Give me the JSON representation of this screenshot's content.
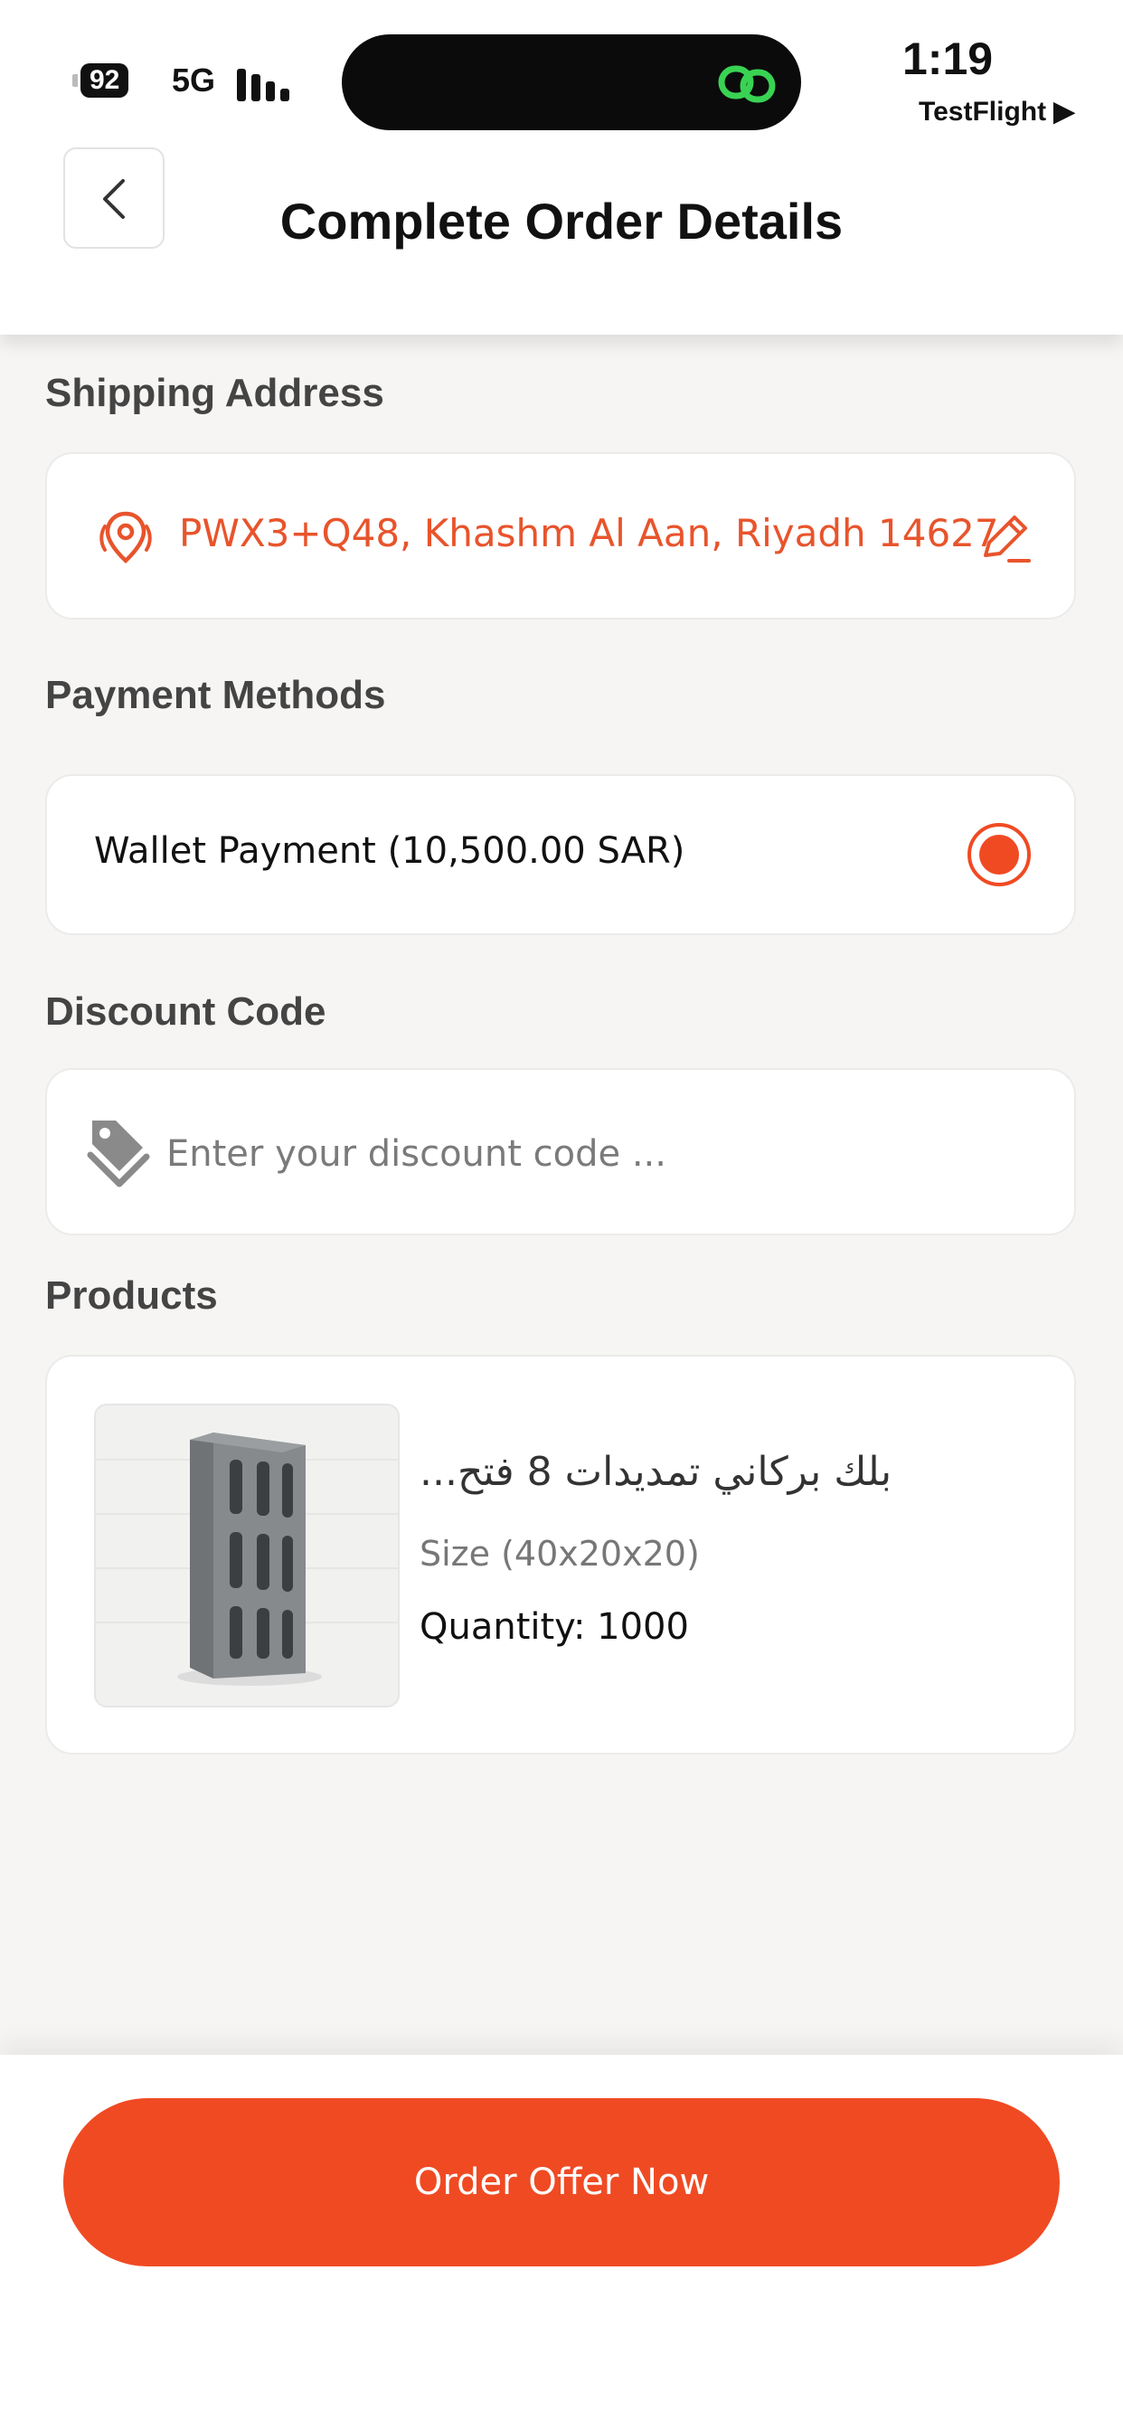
{
  "status_bar": {
    "battery": "92",
    "network": "5G",
    "time": "1:19",
    "back_app": "TestFlight ▶"
  },
  "header": {
    "title": "Complete Order Details"
  },
  "shipping": {
    "label": "Shipping Address",
    "address": "PWX3+Q48, Khashm Al Aan, Riyadh 14627"
  },
  "payment": {
    "label": "Payment Methods",
    "option": "Wallet Payment (10,500.00 SAR)",
    "selected": true
  },
  "discount": {
    "label": "Discount Code",
    "placeholder": "Enter your discount code ...",
    "value": ""
  },
  "products": {
    "label": "Products",
    "items": [
      {
        "name": "بلك بركاني  تمديدات 8 فتح...",
        "size": "Size (40x20x20)",
        "quantity": "Quantity: 1000"
      }
    ]
  },
  "footer": {
    "button_label": "Order Offer Now"
  },
  "colors": {
    "accent": "#f04a23",
    "address_text": "#e8542c",
    "background": "#f6f5f3"
  }
}
